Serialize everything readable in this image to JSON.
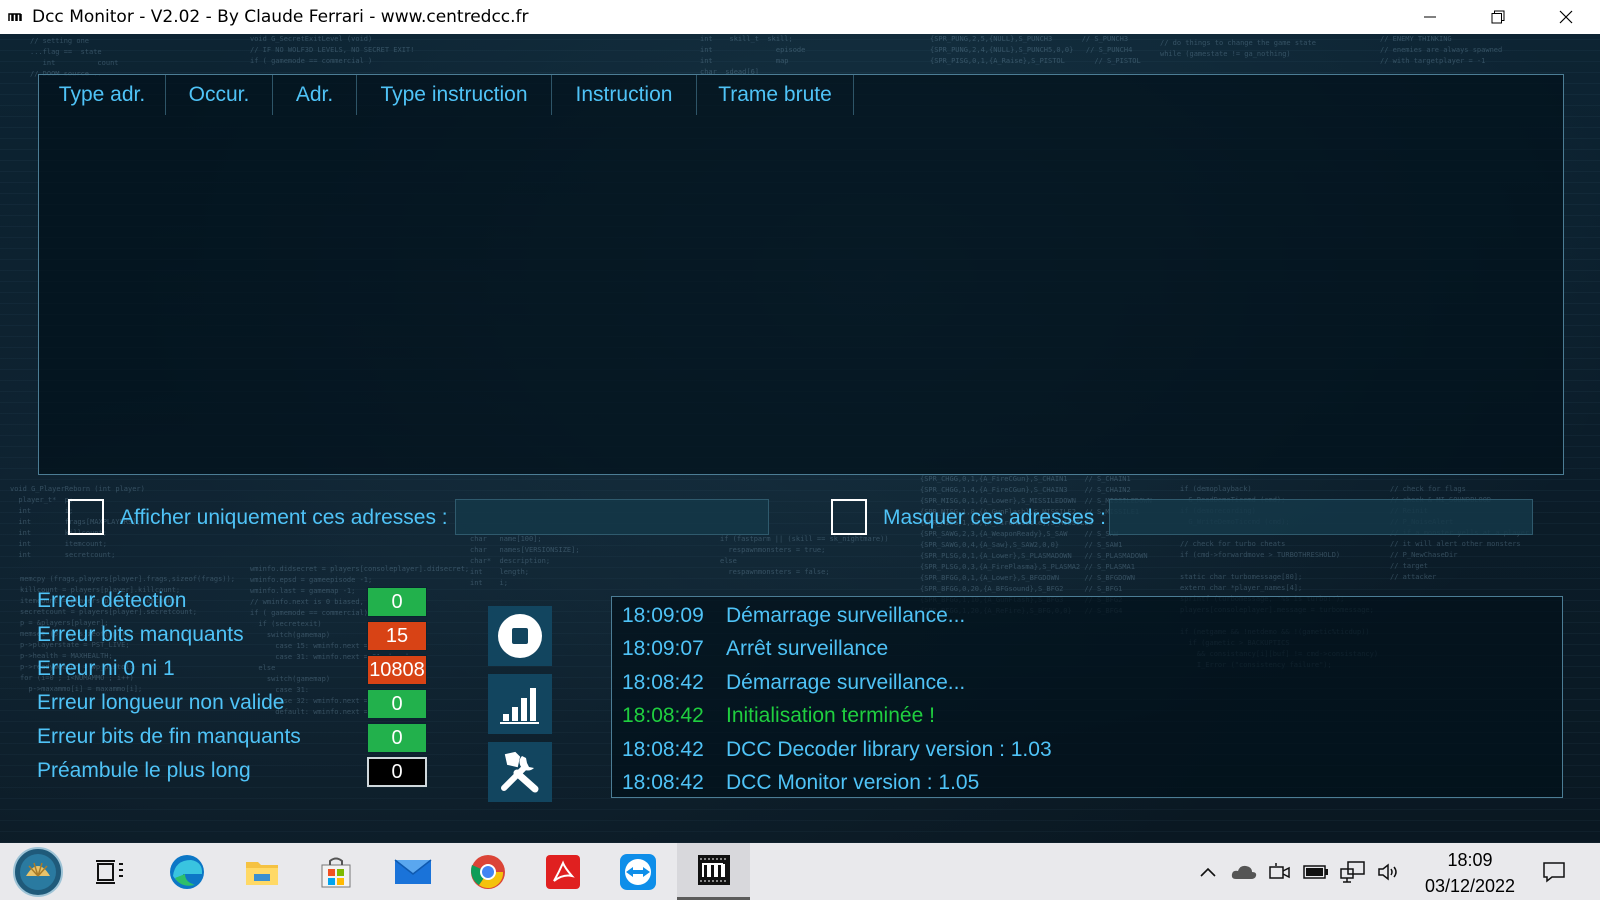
{
  "window": {
    "title": "Dcc Monitor - V2.02 - By Claude Ferrari - www.centredcc.fr",
    "app_icon": "dcc-chip-icon"
  },
  "table": {
    "columns": [
      "Type adr.",
      "Occur.",
      "Adr.",
      "Type instruction",
      "Instruction",
      "Trame brute"
    ],
    "rows": []
  },
  "filters": {
    "show_only_label": "Afficher uniquement ces adresses :",
    "show_only_checked": false,
    "show_only_value": "",
    "hide_label": "Masquer ces adresses :",
    "hide_checked": false,
    "hide_value": ""
  },
  "errors": [
    {
      "label": "Erreur détection",
      "value": "0",
      "status": "ok",
      "color": "#22b14c"
    },
    {
      "label": "Erreur bits manquants",
      "value": "15",
      "status": "error",
      "color": "#d84315"
    },
    {
      "label": "Erreur ni 0 ni 1",
      "value": "10808",
      "status": "error",
      "color": "#d84315"
    },
    {
      "label": "Erreur longueur non valide",
      "value": "0",
      "status": "ok",
      "color": "#22b14c"
    },
    {
      "label": "Erreur bits de fin manquants",
      "value": "0",
      "status": "ok",
      "color": "#22b14c"
    },
    {
      "label": "Préambule le plus long",
      "value": "0",
      "status": "neutral",
      "color": "#000000"
    }
  ],
  "actions": [
    {
      "name": "stop-button",
      "icon": "stop-icon"
    },
    {
      "name": "statistics-button",
      "icon": "bar-chart-icon"
    },
    {
      "name": "settings-button",
      "icon": "tools-icon"
    }
  ],
  "log": [
    {
      "time": "18:09:09",
      "message": "Démarrage surveillance...",
      "level": "info"
    },
    {
      "time": "18:09:07",
      "message": "Arrêt surveillance",
      "level": "info"
    },
    {
      "time": "18:08:42",
      "message": "Démarrage surveillance...",
      "level": "info"
    },
    {
      "time": "18:08:42",
      "message": "Initialisation terminée !",
      "level": "success"
    },
    {
      "time": "18:08:42",
      "message": "DCC Decoder library version : 1.03",
      "level": "info"
    },
    {
      "time": "18:08:42",
      "message": "DCC Monitor version : 1.05",
      "level": "info"
    }
  ],
  "colors": {
    "accent": "#4fc3f7",
    "success": "#1fcf3f",
    "ok_box": "#22b14c",
    "error_box": "#d84315"
  },
  "taskbar": {
    "apps": [
      "start-orb-icon",
      "task-view-icon",
      "edge-icon",
      "file-explorer-icon",
      "store-icon",
      "mail-icon",
      "chrome-icon",
      "acrobat-icon",
      "teamviewer-icon",
      "dcc-monitor-icon"
    ],
    "clock_time": "18:09",
    "clock_date": "03/12/2022"
  }
}
